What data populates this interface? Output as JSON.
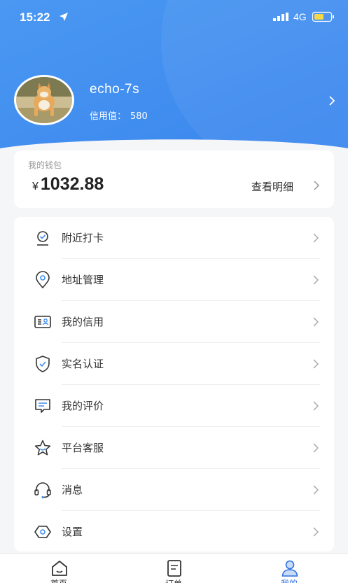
{
  "status_bar": {
    "time": "15:22",
    "network": "4G"
  },
  "profile": {
    "username": "echo-7s",
    "credit_label": "信用值：",
    "credit_value": "580"
  },
  "wallet": {
    "title": "我的钱包",
    "currency": "¥",
    "amount": "1032.88",
    "detail_label": "查看明细"
  },
  "menu": [
    {
      "label": "附近打卡",
      "icon": "check-in-icon"
    },
    {
      "label": "地址管理",
      "icon": "location-pin-icon"
    },
    {
      "label": "我的信用",
      "icon": "id-card-icon"
    },
    {
      "label": "实名认证",
      "icon": "shield-check-icon"
    },
    {
      "label": "我的评价",
      "icon": "comment-icon"
    },
    {
      "label": "平台客服",
      "icon": "star-icon"
    },
    {
      "label": "消息",
      "icon": "headset-icon"
    },
    {
      "label": "设置",
      "icon": "settings-hexagon-icon"
    }
  ],
  "tabs": [
    {
      "label": "首页",
      "icon": "home-icon"
    },
    {
      "label": "订单",
      "icon": "order-icon"
    },
    {
      "label": "我的",
      "icon": "user-icon"
    }
  ],
  "colors": {
    "primary": "#3f8ff0",
    "primary_light": "#5aa2f5",
    "active_tab": "#2d6fe0"
  }
}
